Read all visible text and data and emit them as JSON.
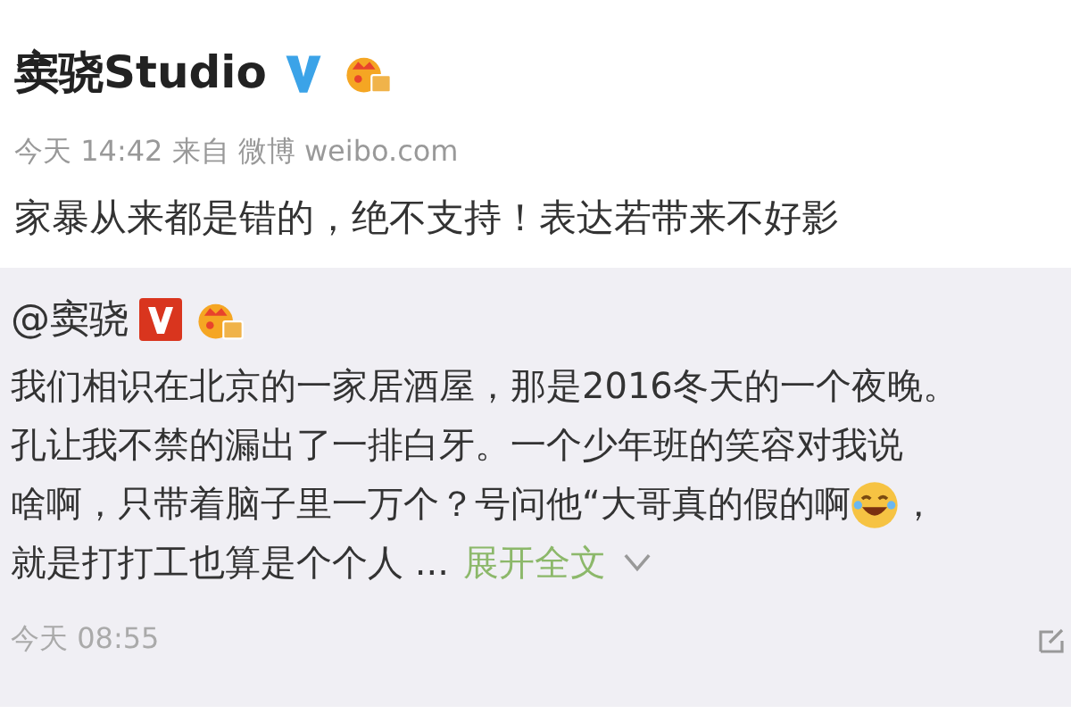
{
  "post": {
    "author": "窦骁Studio",
    "meta": "今天 14:42 来自 微博 weibo.com",
    "text": "家暴从来都是错的，绝不支持！表达若带来不好影"
  },
  "repost": {
    "author": "@窦骁",
    "lines": [
      [
        {
          "kind": "text",
          "text": "我们相识在北京的一家居酒屋，那是2016冬天的一个夜晚。"
        }
      ],
      [
        {
          "kind": "text",
          "text": "孔让我不禁的漏出了一排白牙。一个少年班的笑容对我说"
        }
      ],
      [
        {
          "kind": "text",
          "text": "啥啊，只带着脑子里一万个？号问他“大哥真的假的啊"
        },
        {
          "kind": "emoji"
        },
        {
          "kind": "text",
          "text": "，"
        }
      ],
      [
        {
          "kind": "text",
          "text": "就是打打工也算是个个人 ..."
        },
        {
          "kind": "link",
          "text": "展开全文"
        }
      ]
    ],
    "time": "今天 08:55"
  }
}
